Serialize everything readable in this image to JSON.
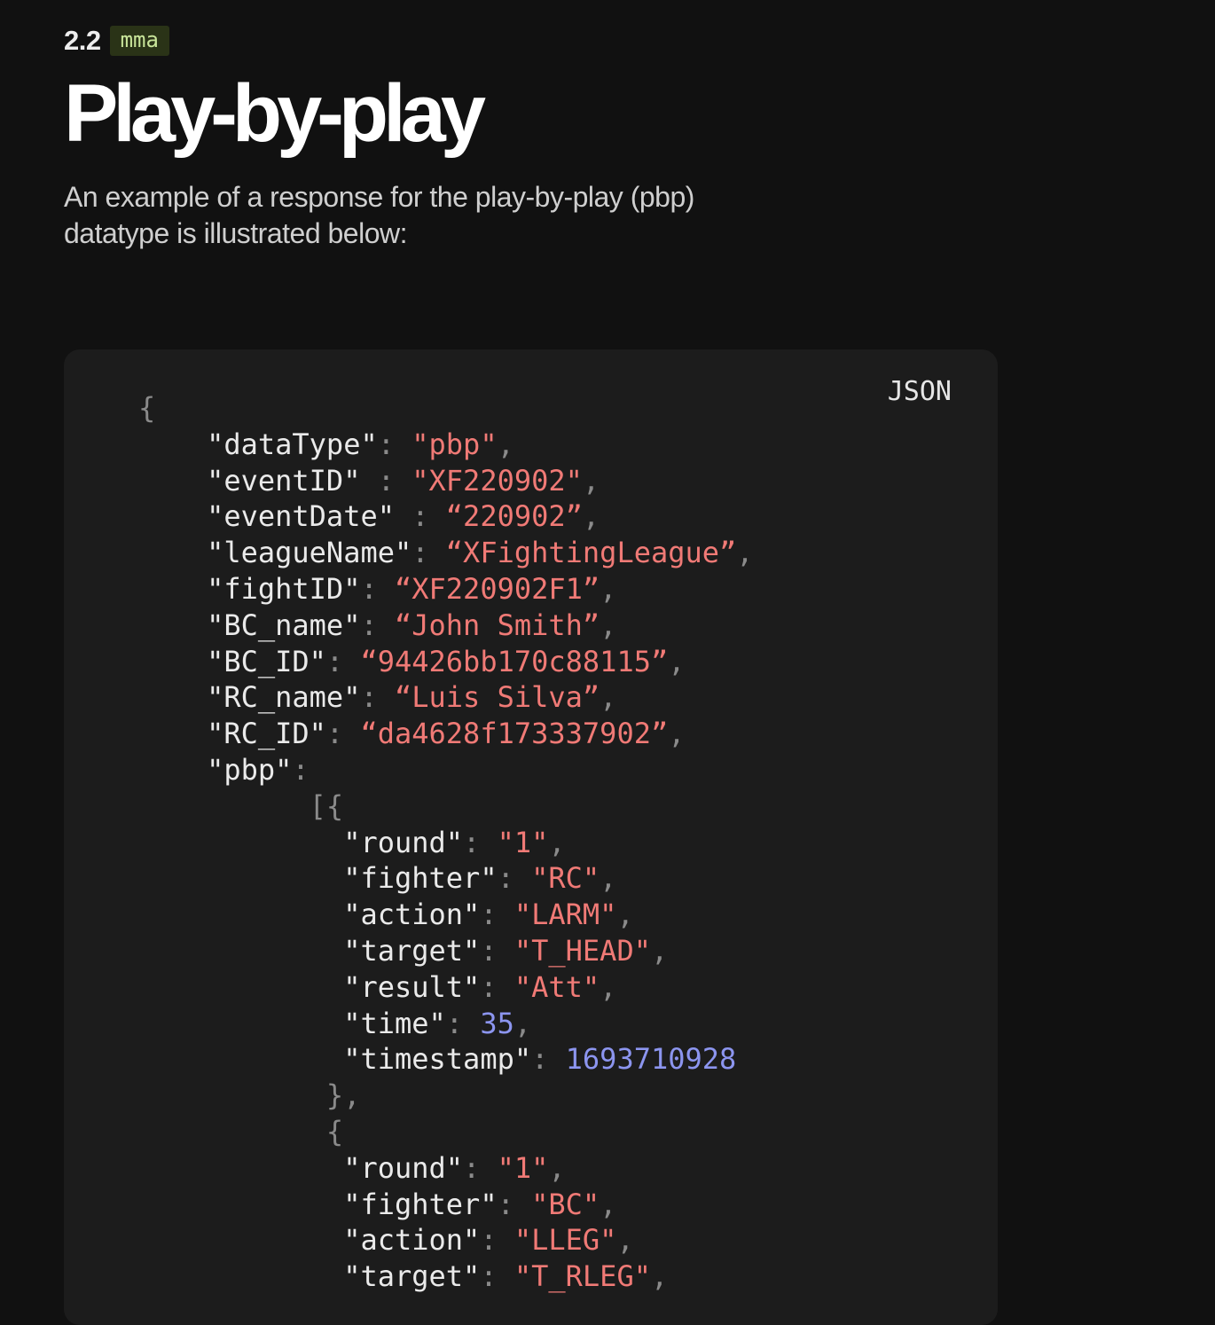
{
  "section": {
    "number": "2.2",
    "tag": "mma"
  },
  "title": "Play-by-play",
  "intro": "An example of a response for the play-by-play (pbp) datatype is illustrated below:",
  "code_block": {
    "language": "JSON",
    "lines": [
      [
        {
          "t": "p",
          "v": "{"
        }
      ],
      [
        {
          "t": "p",
          "v": "    "
        },
        {
          "t": "k",
          "v": "\"dataType\""
        },
        {
          "t": "p",
          "v": ": "
        },
        {
          "t": "s",
          "v": "\"pbp\""
        },
        {
          "t": "p",
          "v": ","
        }
      ],
      [
        {
          "t": "p",
          "v": "    "
        },
        {
          "t": "k",
          "v": "\"eventID\""
        },
        {
          "t": "p",
          "v": " : "
        },
        {
          "t": "s",
          "v": "\"XF220902\""
        },
        {
          "t": "p",
          "v": ","
        }
      ],
      [
        {
          "t": "p",
          "v": "    "
        },
        {
          "t": "k",
          "v": "\"eventDate\""
        },
        {
          "t": "p",
          "v": " : "
        },
        {
          "t": "s",
          "v": "“220902”"
        },
        {
          "t": "p",
          "v": ","
        }
      ],
      [
        {
          "t": "p",
          "v": "    "
        },
        {
          "t": "k",
          "v": "\"leagueName\""
        },
        {
          "t": "p",
          "v": ": "
        },
        {
          "t": "s",
          "v": "“XFightingLeague”"
        },
        {
          "t": "p",
          "v": ","
        }
      ],
      [
        {
          "t": "p",
          "v": "    "
        },
        {
          "t": "k",
          "v": "\"fightID\""
        },
        {
          "t": "p",
          "v": ": "
        },
        {
          "t": "s",
          "v": "“XF220902F1”"
        },
        {
          "t": "p",
          "v": ","
        }
      ],
      [
        {
          "t": "p",
          "v": "    "
        },
        {
          "t": "k",
          "v": "\"BC_name\""
        },
        {
          "t": "p",
          "v": ": "
        },
        {
          "t": "s",
          "v": "“John Smith”"
        },
        {
          "t": "p",
          "v": ","
        }
      ],
      [
        {
          "t": "p",
          "v": "    "
        },
        {
          "t": "k",
          "v": "\"BC_ID\""
        },
        {
          "t": "p",
          "v": ": "
        },
        {
          "t": "s",
          "v": "“94426bb170c88115”"
        },
        {
          "t": "p",
          "v": ","
        }
      ],
      [
        {
          "t": "p",
          "v": "    "
        },
        {
          "t": "k",
          "v": "\"RC_name\""
        },
        {
          "t": "p",
          "v": ": "
        },
        {
          "t": "s",
          "v": "“Luis Silva”"
        },
        {
          "t": "p",
          "v": ","
        }
      ],
      [
        {
          "t": "p",
          "v": "    "
        },
        {
          "t": "k",
          "v": "\"RC_ID\""
        },
        {
          "t": "p",
          "v": ": "
        },
        {
          "t": "s",
          "v": "“da4628f173337902”"
        },
        {
          "t": "p",
          "v": ","
        }
      ],
      [
        {
          "t": "p",
          "v": "    "
        },
        {
          "t": "k",
          "v": "\"pbp\""
        },
        {
          "t": "p",
          "v": ":"
        }
      ],
      [
        {
          "t": "p",
          "v": "          [{"
        }
      ],
      [
        {
          "t": "p",
          "v": "            "
        },
        {
          "t": "k",
          "v": "\"round\""
        },
        {
          "t": "p",
          "v": ": "
        },
        {
          "t": "s",
          "v": "\"1\""
        },
        {
          "t": "p",
          "v": ","
        }
      ],
      [
        {
          "t": "p",
          "v": "            "
        },
        {
          "t": "k",
          "v": "\"fighter\""
        },
        {
          "t": "p",
          "v": ": "
        },
        {
          "t": "s",
          "v": "\"RC\""
        },
        {
          "t": "p",
          "v": ","
        }
      ],
      [
        {
          "t": "p",
          "v": "            "
        },
        {
          "t": "k",
          "v": "\"action\""
        },
        {
          "t": "p",
          "v": ": "
        },
        {
          "t": "s",
          "v": "\"LARM\""
        },
        {
          "t": "p",
          "v": ","
        }
      ],
      [
        {
          "t": "p",
          "v": "            "
        },
        {
          "t": "k",
          "v": "\"target\""
        },
        {
          "t": "p",
          "v": ": "
        },
        {
          "t": "s",
          "v": "\"T_HEAD\""
        },
        {
          "t": "p",
          "v": ","
        }
      ],
      [
        {
          "t": "p",
          "v": "            "
        },
        {
          "t": "k",
          "v": "\"result\""
        },
        {
          "t": "p",
          "v": ": "
        },
        {
          "t": "s",
          "v": "\"Att\""
        },
        {
          "t": "p",
          "v": ","
        }
      ],
      [
        {
          "t": "p",
          "v": "            "
        },
        {
          "t": "k",
          "v": "\"time\""
        },
        {
          "t": "p",
          "v": ": "
        },
        {
          "t": "n",
          "v": "35"
        },
        {
          "t": "p",
          "v": ","
        }
      ],
      [
        {
          "t": "p",
          "v": "            "
        },
        {
          "t": "k",
          "v": "\"timestamp\""
        },
        {
          "t": "p",
          "v": ": "
        },
        {
          "t": "n",
          "v": "1693710928"
        }
      ],
      [
        {
          "t": "p",
          "v": "           },"
        }
      ],
      [
        {
          "t": "p",
          "v": "           {"
        }
      ],
      [
        {
          "t": "p",
          "v": "            "
        },
        {
          "t": "k",
          "v": "\"round\""
        },
        {
          "t": "p",
          "v": ": "
        },
        {
          "t": "s",
          "v": "\"1\""
        },
        {
          "t": "p",
          "v": ","
        }
      ],
      [
        {
          "t": "p",
          "v": "            "
        },
        {
          "t": "k",
          "v": "\"fighter\""
        },
        {
          "t": "p",
          "v": ": "
        },
        {
          "t": "s",
          "v": "\"BC\""
        },
        {
          "t": "p",
          "v": ","
        }
      ],
      [
        {
          "t": "p",
          "v": "            "
        },
        {
          "t": "k",
          "v": "\"action\""
        },
        {
          "t": "p",
          "v": ": "
        },
        {
          "t": "s",
          "v": "\"LLEG\""
        },
        {
          "t": "p",
          "v": ","
        }
      ],
      [
        {
          "t": "p",
          "v": "            "
        },
        {
          "t": "k",
          "v": "\"target\""
        },
        {
          "t": "p",
          "v": ": "
        },
        {
          "t": "s",
          "v": "\"T_RLEG\""
        },
        {
          "t": "p",
          "v": ","
        }
      ]
    ]
  }
}
